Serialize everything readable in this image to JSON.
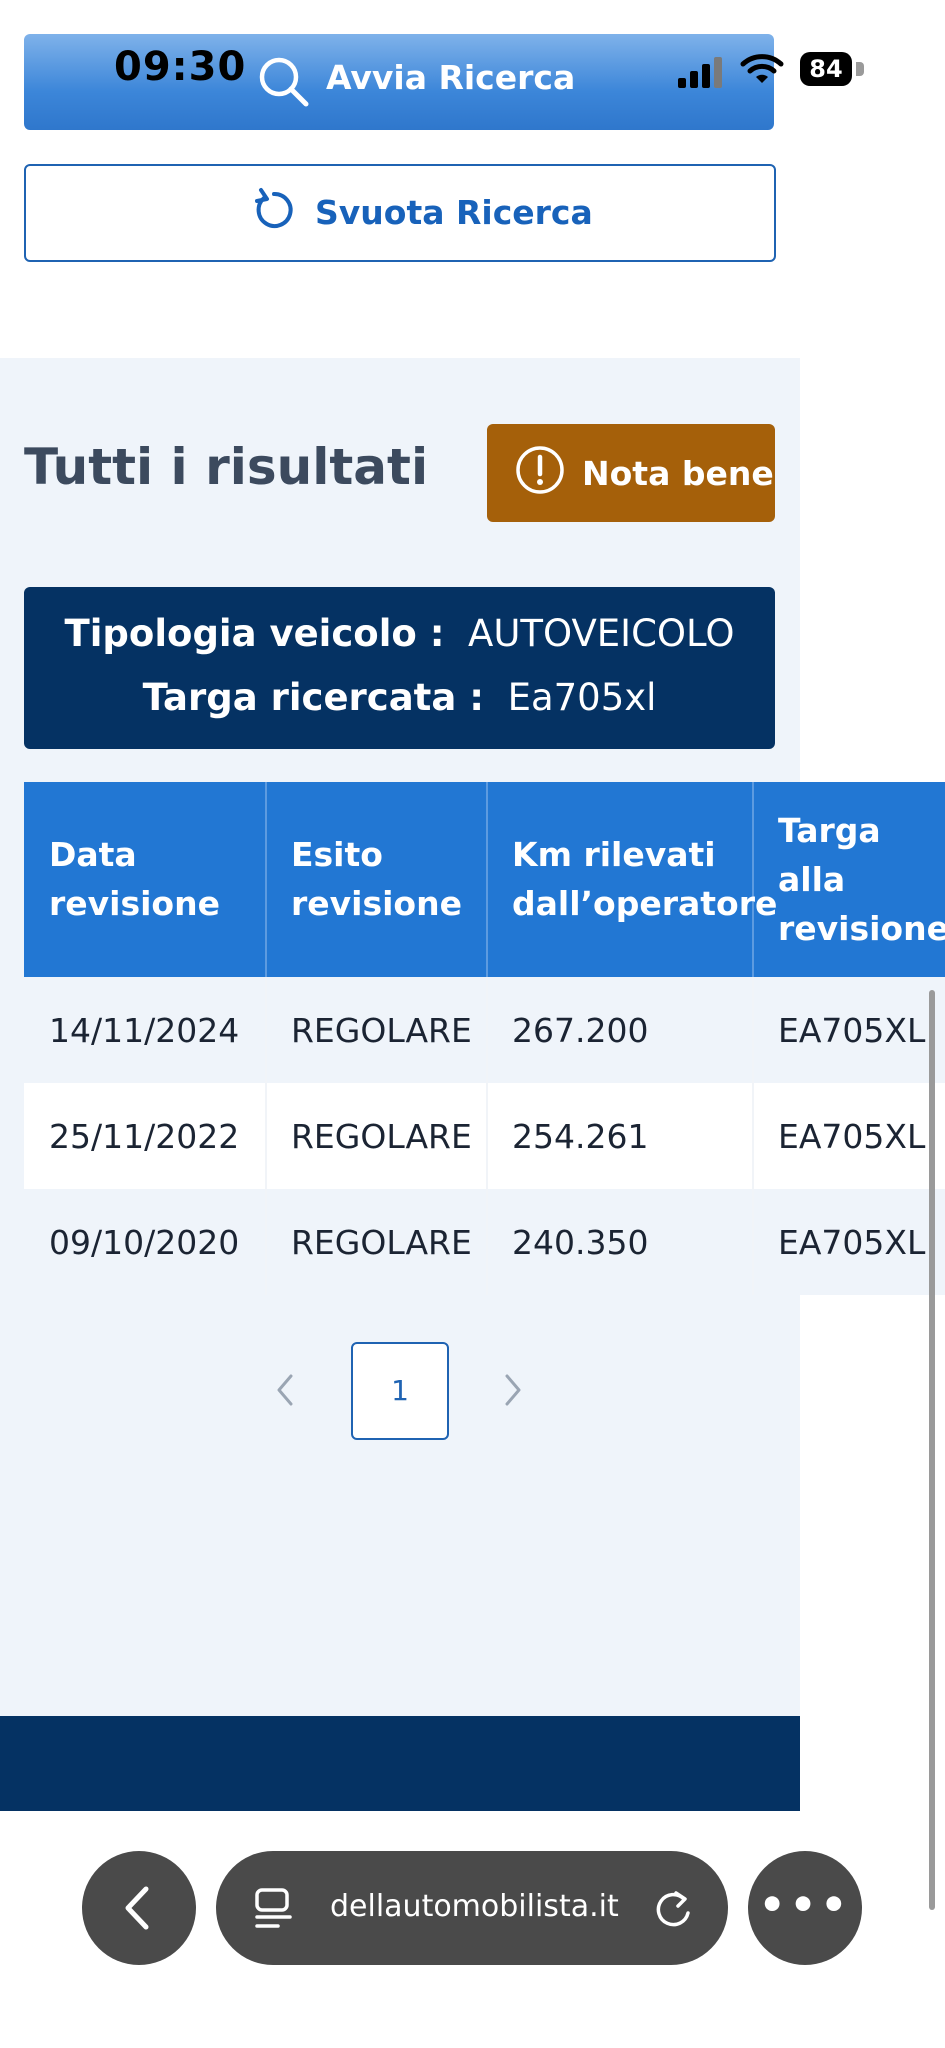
{
  "status_bar": {
    "time": "09:30",
    "battery": "84"
  },
  "search": {
    "start_label": "Avvia Ricerca",
    "clear_label": "Svuota Ricerca"
  },
  "results": {
    "title": "Tutti i risultati",
    "note_button": "Nota bene",
    "vehicle_type_label": "Tipologia veicolo :",
    "vehicle_type_value": "AUTOVEICOLO",
    "plate_label": "Targa ricercata :",
    "plate_value": "Ea705xl"
  },
  "table": {
    "headers": [
      [
        "Data",
        "revisione"
      ],
      [
        "Esito",
        "revisione"
      ],
      [
        "Km rilevati",
        "dall’operatore"
      ],
      [
        "Targa",
        "alla",
        "revisione"
      ]
    ],
    "rows": [
      [
        "14/11/2024",
        "REGOLARE",
        "267.200",
        "EA705XL"
      ],
      [
        "25/11/2022",
        "REGOLARE",
        "254.261",
        "EA705XL"
      ],
      [
        "09/10/2020",
        "REGOLARE",
        "240.350",
        "EA705XL"
      ]
    ]
  },
  "pagination": {
    "current_page": "1"
  },
  "browser": {
    "url": "dellautomobilista.it"
  },
  "colors": {
    "primary_blue": "#2277d3",
    "navy": "#053263",
    "warning": "#a5600a"
  }
}
